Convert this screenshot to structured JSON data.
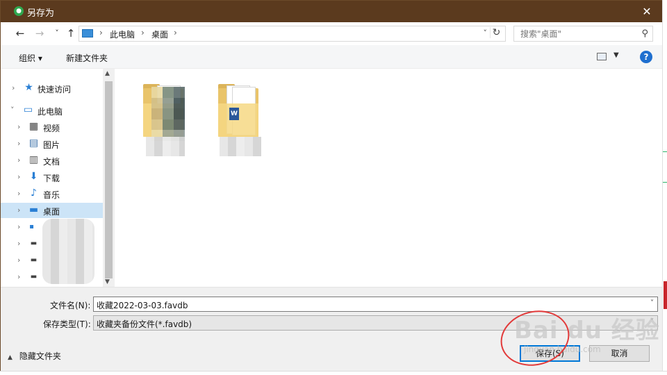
{
  "window": {
    "title": "另存为",
    "close_glyph": "✕",
    "app_icon": "save-app-icon"
  },
  "address": {
    "back_glyph": "←",
    "forward_glyph": "→",
    "recent_glyph": "˅",
    "up_glyph": "↑",
    "crumbs": [
      "此电脑",
      "桌面"
    ],
    "separator": "›",
    "dropdown_glyph": "˅",
    "refresh_glyph": "↻",
    "search_placeholder": "搜索\"桌面\"",
    "search_glyph": "⚲"
  },
  "toolbar": {
    "organize": "组织 ▾",
    "new_folder": "新建文件夹",
    "view_dd_glyph": "▼",
    "help": "?"
  },
  "nav_tree": {
    "items": [
      {
        "label": "快速访问",
        "icon": "star-icon",
        "glyph": "★",
        "color": "#2a7fd4"
      },
      {
        "label": "此电脑",
        "icon": "computer-icon",
        "glyph": "▭",
        "color": "#2a7fd4"
      },
      {
        "label": "视频",
        "icon": "video-icon",
        "glyph": "▦",
        "color": "#3a3a3a"
      },
      {
        "label": "图片",
        "icon": "picture-icon",
        "glyph": "▤",
        "color": "#3a6fa8"
      },
      {
        "label": "文档",
        "icon": "document-icon",
        "glyph": "▥",
        "color": "#5a5a5a"
      },
      {
        "label": "下载",
        "icon": "download-icon",
        "glyph": "⬇",
        "color": "#2a7fd4"
      },
      {
        "label": "音乐",
        "icon": "music-icon",
        "glyph": "♪",
        "color": "#2a7fd4"
      },
      {
        "label": "桌面",
        "icon": "desktop-icon",
        "glyph": "▬",
        "color": "#2a7fd4"
      },
      {
        "label": "",
        "icon": "windows-drive-icon",
        "glyph": "▪",
        "color": "#2a7fd4"
      },
      {
        "label": "",
        "icon": "drive-icon",
        "glyph": "▬",
        "color": "#444444"
      },
      {
        "label": "",
        "icon": "drive-icon",
        "glyph": "▬",
        "color": "#444444"
      },
      {
        "label": "",
        "icon": "drive-icon",
        "glyph": "▬",
        "color": "#444444"
      }
    ],
    "chevron_right": "›",
    "chevron_down": "˅",
    "scroll_up": "▲",
    "scroll_down": "▼"
  },
  "save_form": {
    "filename_label": "文件名(N):",
    "filename_value": "收藏2022-03-03.favdb",
    "filetype_label": "保存类型(T):",
    "filetype_value": "收藏夹备份文件(*.favdb)",
    "dropdown_glyph": "˅",
    "hide_folders": "隐藏文件夹",
    "hide_caret": "▲",
    "save_button": "保存(S)",
    "cancel_button": "取消"
  },
  "colors": {
    "titlebar": "#5b3a1e",
    "selected": "#cce4f7",
    "accent": "#0078d7",
    "annotation": "#e23a3a"
  },
  "watermark": {
    "text": "Bai du 经验",
    "sub": "jingyan.baidu.com"
  }
}
